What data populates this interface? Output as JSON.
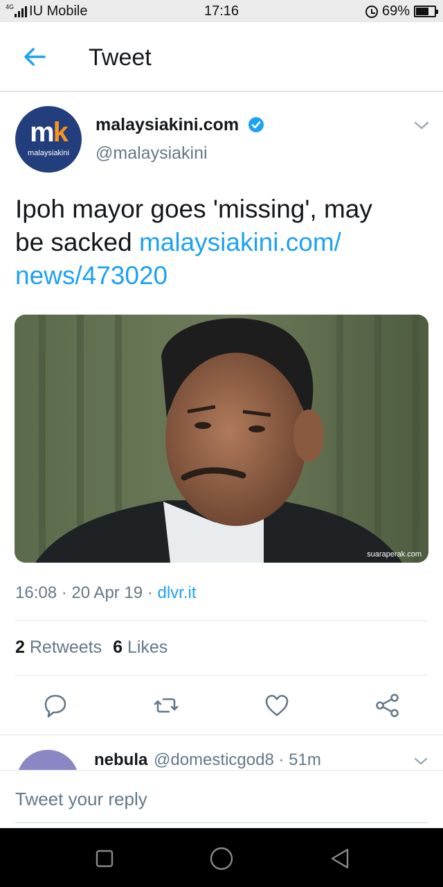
{
  "status_bar": {
    "network": "4G",
    "carrier": "IU Mobile",
    "time": "17:16",
    "battery": "69%",
    "battery_level": 0.69,
    "icons": [
      "signal-icon",
      "alarm-icon",
      "battery-icon"
    ]
  },
  "header": {
    "back_icon": "back-arrow-icon",
    "title": "Tweet"
  },
  "tweet": {
    "avatar": {
      "logo_text": "mk",
      "logo_caption": "malaysiakini"
    },
    "display_name": "malaysiakini.com",
    "verified": true,
    "handle": "@malaysiakini",
    "text": "Ipoh mayor goes 'missing', may be sacked ",
    "link_line1": "malaysiakini.com/",
    "link_line2": "news/473020",
    "photo": {
      "credit": "suaraperak.com"
    },
    "time": "16:08",
    "date": "20 Apr 19",
    "separator": " · ",
    "source": "dlvr.it",
    "retweets_count": "2",
    "retweets_label": "Retweets",
    "likes_count": "6",
    "likes_label": "Likes",
    "actions": [
      "reply-icon",
      "retweet-icon",
      "like-icon",
      "share-icon"
    ]
  },
  "reply_preview": {
    "name": "nebula",
    "handle": "@domesticgod8",
    "age": "51m"
  },
  "composer": {
    "placeholder": "Tweet your reply"
  },
  "nav_bar": {
    "buttons": [
      "recents-icon",
      "home-icon",
      "back-icon"
    ]
  },
  "colors": {
    "accent": "#1da1f2",
    "secondary_text": "#657786",
    "primary_text": "#14171a",
    "logo_bg": "#233e7c"
  }
}
